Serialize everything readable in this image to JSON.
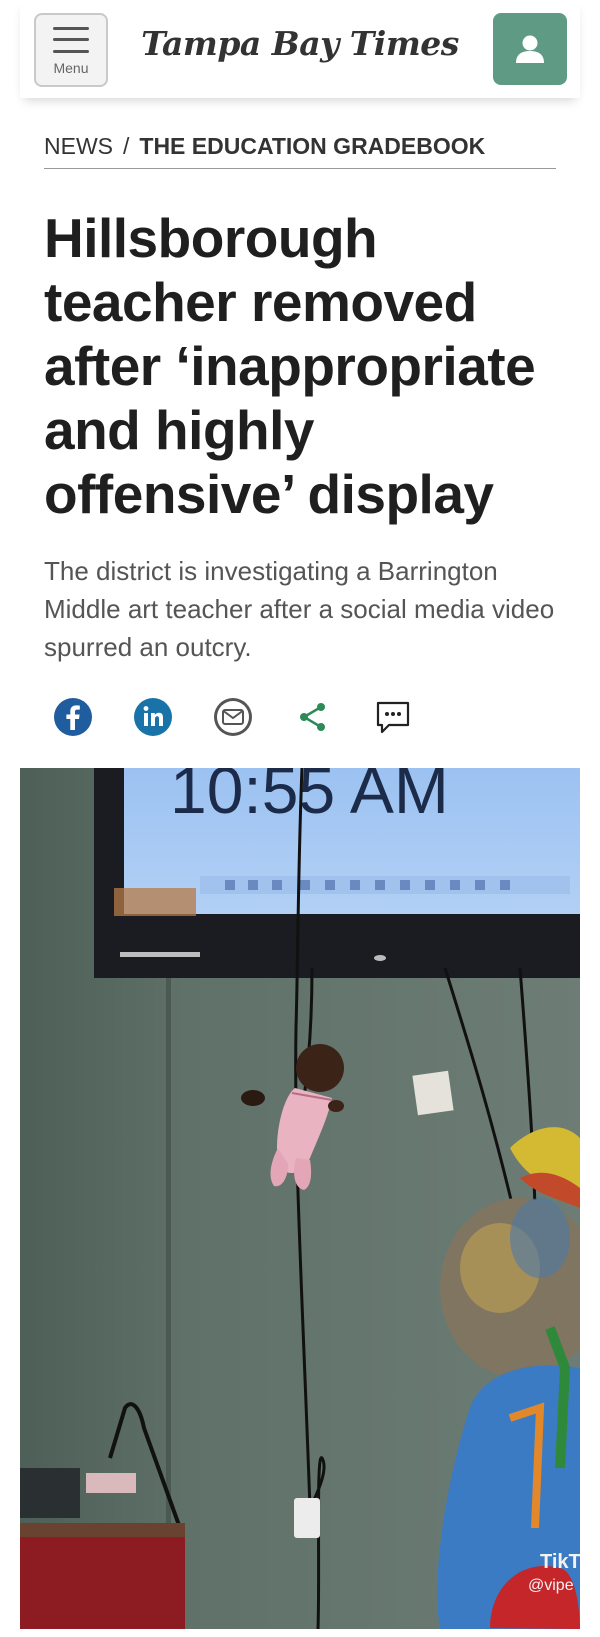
{
  "header": {
    "menu_label": "Menu",
    "logo_text": "Tampa Bay Times",
    "icons": {
      "menu": "hamburger-icon",
      "account": "user-icon"
    },
    "colors": {
      "account_bg": "#5f9a85"
    }
  },
  "breadcrumb": {
    "primary": "NEWS",
    "separator": "/",
    "section": "THE EDUCATION GRADEBOOK"
  },
  "article": {
    "headline_lines": [
      "Hillsborough",
      "teacher removed",
      "after ‘inappropriate",
      "and highly",
      "offensive’ display"
    ],
    "dek": "The district is investigating a Barrington Middle art teacher after a social media video spurred an outcry."
  },
  "share": {
    "buttons": [
      {
        "name": "facebook-share-button",
        "icon": "facebook-icon",
        "color": "#1f5d9e"
      },
      {
        "name": "linkedin-share-button",
        "icon": "linkedin-icon",
        "color": "#1a73a8"
      },
      {
        "name": "email-share-button",
        "icon": "email-icon",
        "color": "#555555"
      },
      {
        "name": "share-button",
        "icon": "share-icon",
        "color": "#2e8b57"
      },
      {
        "name": "comments-button",
        "icon": "comment-icon",
        "color": "#222222"
      }
    ]
  },
  "photo": {
    "tv_time": "10:55 AM",
    "watermark": "TikT",
    "watermark_handle": "@vipe"
  }
}
